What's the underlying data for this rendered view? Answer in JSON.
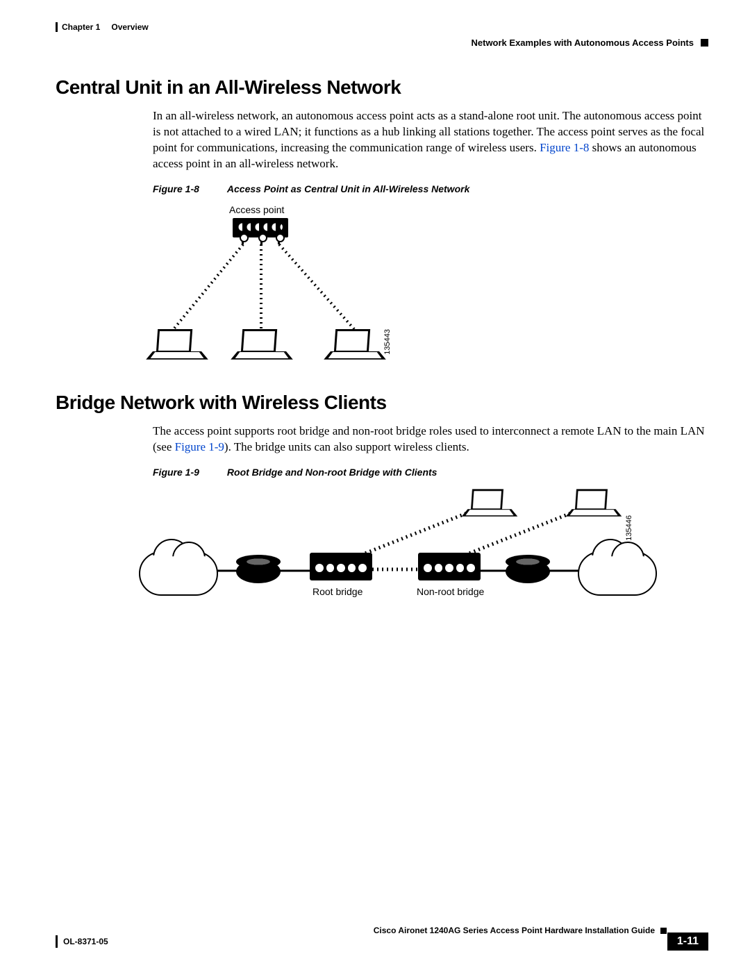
{
  "header": {
    "chapter": "Chapter 1",
    "chapter_title": "Overview",
    "section_path": "Network Examples with Autonomous Access Points"
  },
  "section1": {
    "heading": "Central Unit in an All-Wireless Network",
    "para_a": "In an all-wireless network, an autonomous access point acts as a stand-alone root unit. The autonomous access point is not attached to a wired LAN; it functions as a hub linking all stations together. The access point serves as the focal point for communications, increasing the communication range of wireless users. ",
    "figref": "Figure 1-8",
    "para_b": " shows an autonomous access point in an all-wireless network.",
    "fig_caption_num": "Figure 1-8",
    "fig_caption_text": "Access Point as Central Unit in All-Wireless Network",
    "fig_ap_label": "Access point",
    "fig_id": "135443"
  },
  "section2": {
    "heading": "Bridge Network with Wireless Clients",
    "para_a": "The access point supports root bridge and non-root bridge roles used to interconnect a remote LAN to the main LAN (see ",
    "figref": "Figure 1-9",
    "para_b": "). The bridge units can also support wireless clients.",
    "fig_caption_num": "Figure 1-9",
    "fig_caption_text": "Root Bridge and Non-root Bridge with Clients",
    "fig_root_label": "Root bridge",
    "fig_nonroot_label": "Non-root bridge",
    "fig_id": "135446"
  },
  "footer": {
    "guide_title": "Cisco Aironet 1240AG Series Access Point Hardware Installation Guide",
    "doc_number": "OL-8371-05",
    "page_num": "1-11"
  }
}
